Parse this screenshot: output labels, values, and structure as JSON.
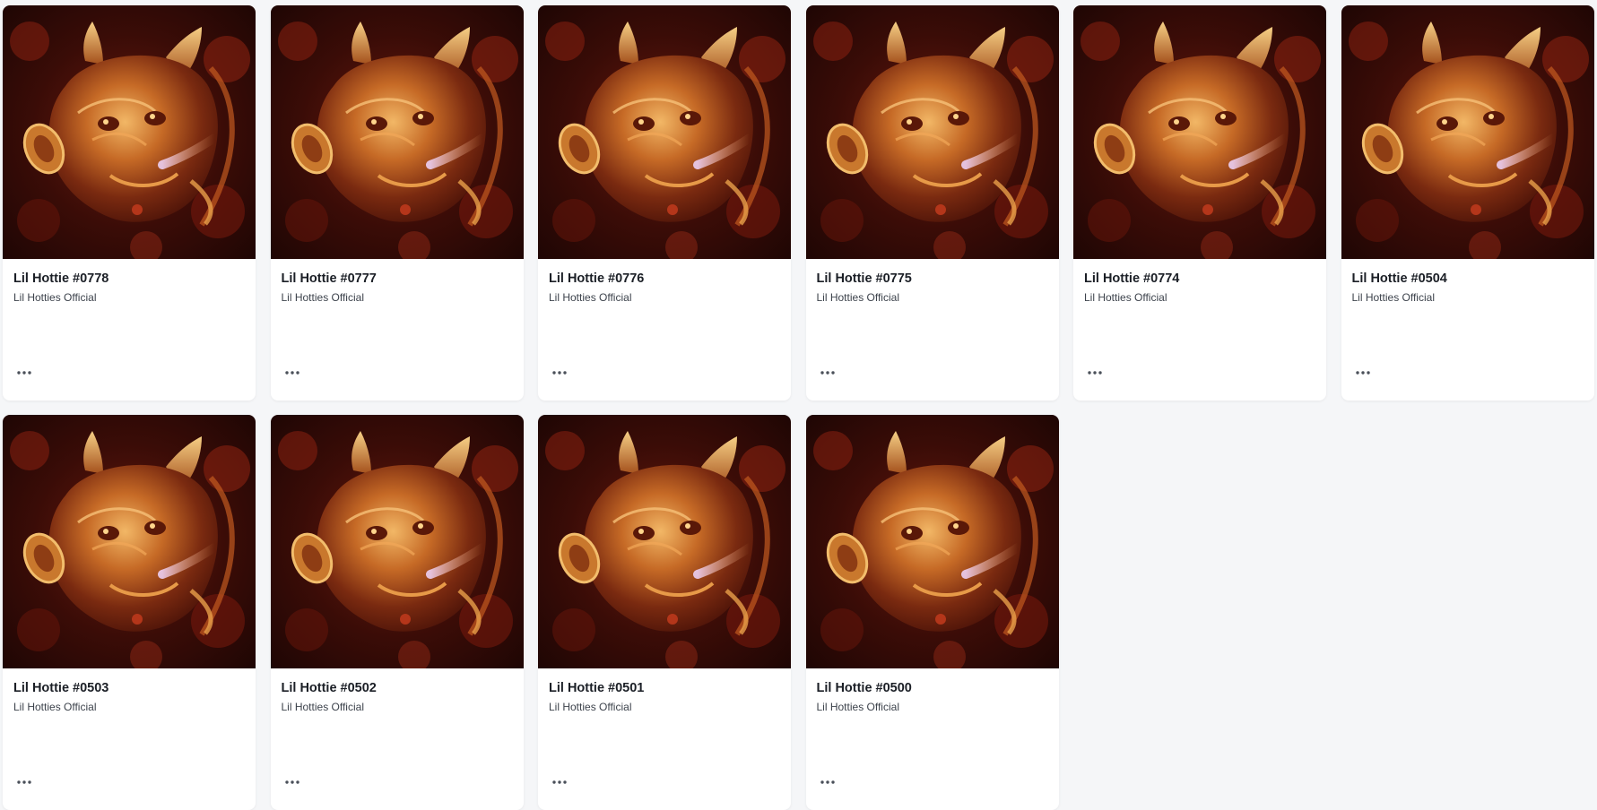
{
  "items": [
    {
      "title": "Lil Hottie #0778",
      "collection": "Lil Hotties Official"
    },
    {
      "title": "Lil Hottie #0777",
      "collection": "Lil Hotties Official"
    },
    {
      "title": "Lil Hottie #0776",
      "collection": "Lil Hotties Official"
    },
    {
      "title": "Lil Hottie #0775",
      "collection": "Lil Hotties Official"
    },
    {
      "title": "Lil Hottie #0774",
      "collection": "Lil Hotties Official"
    },
    {
      "title": "Lil Hottie #0504",
      "collection": "Lil Hotties Official"
    },
    {
      "title": "Lil Hottie #0503",
      "collection": "Lil Hotties Official"
    },
    {
      "title": "Lil Hottie #0502",
      "collection": "Lil Hotties Official"
    },
    {
      "title": "Lil Hottie #0501",
      "collection": "Lil Hotties Official"
    },
    {
      "title": "Lil Hottie #0500",
      "collection": "Lil Hotties Official"
    }
  ],
  "more_icon": "more-horizontal-icon",
  "colors": {
    "background": "#f5f6f8",
    "card": "#ffffff",
    "title": "#1b1f26",
    "subtitle": "#3d434c",
    "art_dark": "#2a0805",
    "art_glow": "#d8852f"
  }
}
